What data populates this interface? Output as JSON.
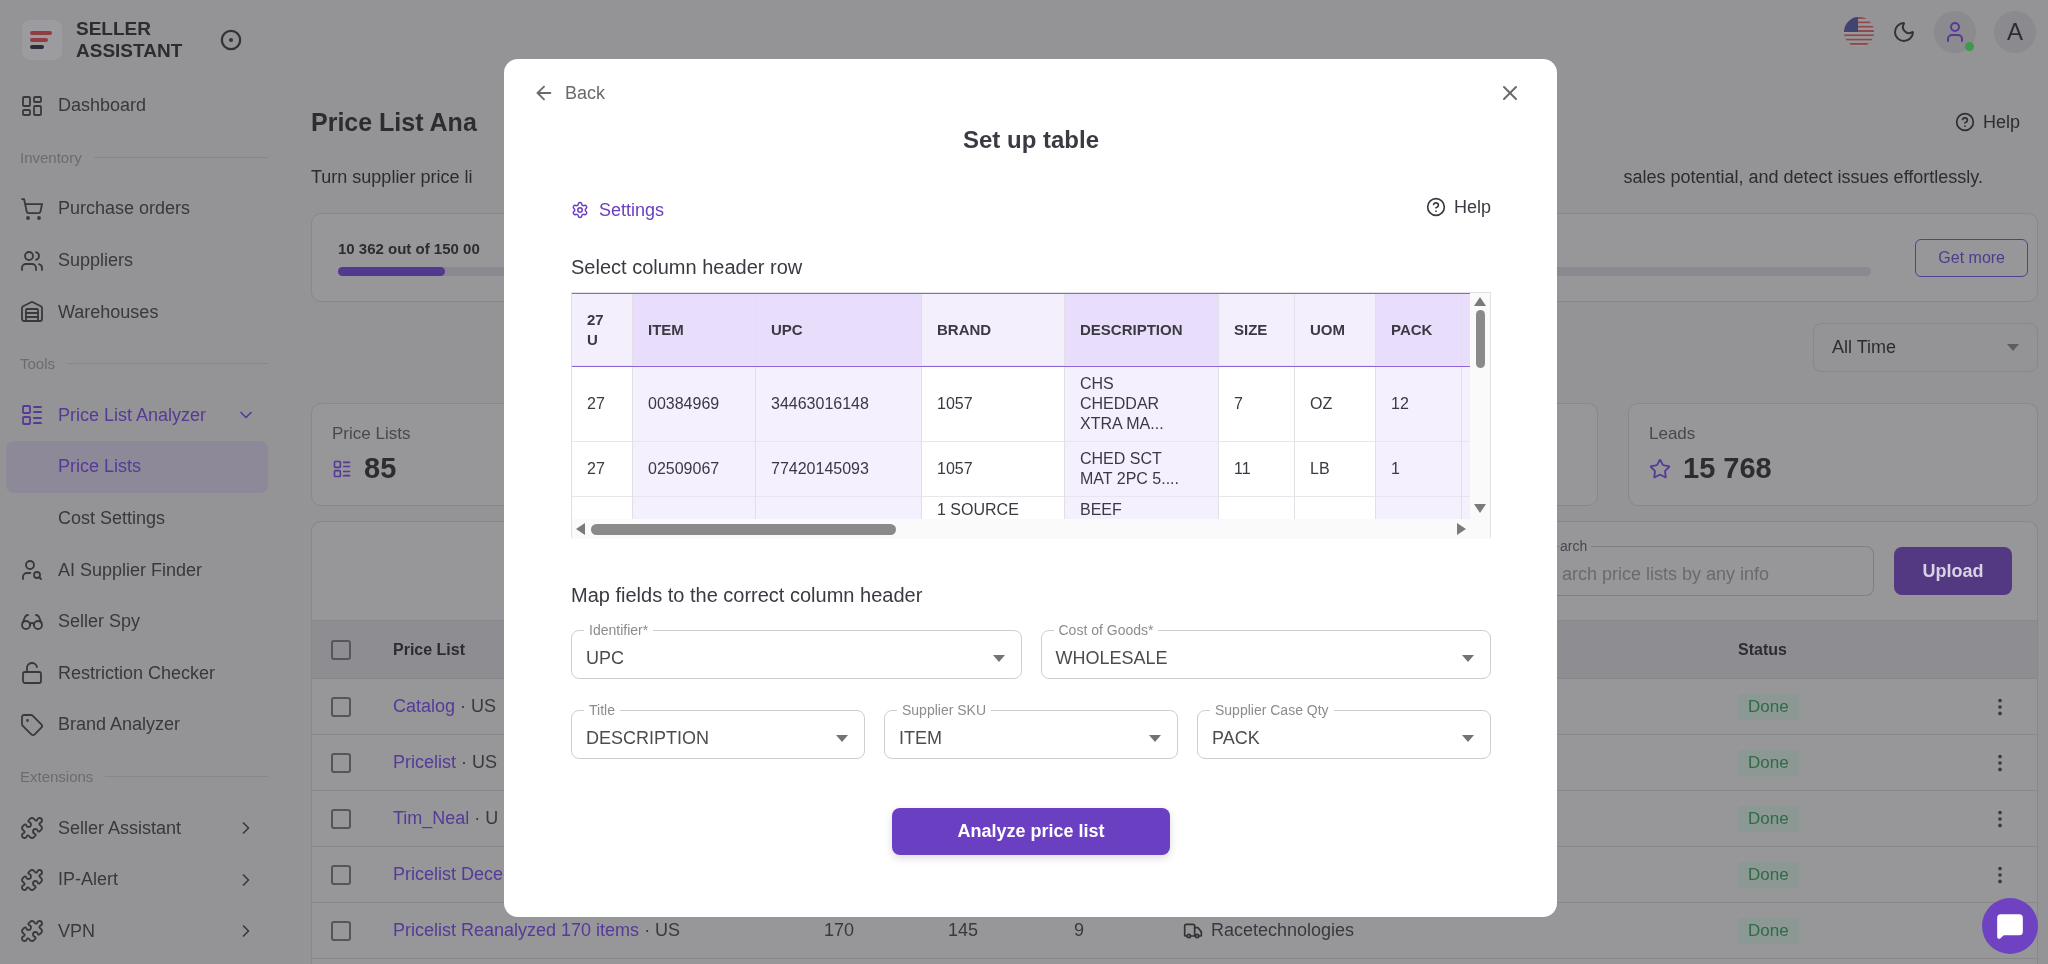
{
  "sidebar": {
    "brand": "SELLER ASSISTANT",
    "items": [
      {
        "kind": "item",
        "label": "Dashboard",
        "selected": false
      },
      {
        "kind": "section",
        "label": "Inventory"
      },
      {
        "kind": "item",
        "label": "Purchase orders",
        "selected": false
      },
      {
        "kind": "item",
        "label": "Suppliers",
        "selected": false
      },
      {
        "kind": "item",
        "label": "Warehouses",
        "selected": false
      },
      {
        "kind": "section",
        "label": "Tools"
      },
      {
        "kind": "item",
        "label": "Price List Analyzer",
        "selected": true,
        "expanded": true
      },
      {
        "kind": "subitem",
        "label": "Price Lists",
        "selected": true
      },
      {
        "kind": "subitem",
        "label": "Cost Settings",
        "selected": false
      },
      {
        "kind": "item",
        "label": "AI Supplier Finder",
        "selected": false
      },
      {
        "kind": "item",
        "label": "Seller Spy",
        "selected": false
      },
      {
        "kind": "item",
        "label": "Restriction Checker",
        "selected": false
      },
      {
        "kind": "item",
        "label": "Brand Analyzer",
        "selected": false
      },
      {
        "kind": "section",
        "label": "Extensions"
      },
      {
        "kind": "item",
        "label": "Seller Assistant",
        "selected": false,
        "expanded": false
      },
      {
        "kind": "item",
        "label": "IP-Alert",
        "selected": false,
        "expanded": false
      },
      {
        "kind": "item",
        "label": "VPN",
        "selected": false,
        "expanded": false
      }
    ]
  },
  "top_bar": {
    "avatar": "A"
  },
  "page": {
    "title": "Price List Ana",
    "help": "Help",
    "subtitle_left": "Turn supplier price li",
    "subtitle_right": "sales potential, and detect issues effortlessly."
  },
  "usage": {
    "text": "10 362 out of 150 00",
    "level": 0.07,
    "button": "Get more"
  },
  "period": {
    "value": "All Time"
  },
  "stats": [
    {
      "label": "Price Lists",
      "value": "85"
    },
    {
      "label": "Leads",
      "value": "15 768"
    }
  ],
  "table": {
    "search": {
      "label": "arch",
      "placeholder": "arch price lists by any info"
    },
    "upload": "Upload",
    "header": {
      "checked": false,
      "name": "Price List",
      "status": "Status"
    },
    "rows": [
      {
        "checked": false,
        "name": "Catalog",
        "suffix": " · US",
        "status": "Done"
      },
      {
        "checked": false,
        "name": "Pricelist",
        "suffix": " · US",
        "status": "Done"
      },
      {
        "checked": false,
        "name": "Tim_Neal",
        "suffix": " · U",
        "status": "Done"
      },
      {
        "checked": false,
        "name": "Pricelist Dece",
        "status": "Done"
      },
      {
        "checked": false,
        "name": "Pricelist Reanalyzed 170 items",
        "suffix": " · US",
        "column_2": "170",
        "column_3": "145",
        "column_4": "9",
        "column_5": "Racetechnologies",
        "status": "Done"
      }
    ]
  },
  "dialog": {
    "back": "Back",
    "title": "Set up table",
    "settings": "Settings",
    "help": "Help",
    "preview_label": "Select column header row",
    "columns": [
      {
        "mapped": false
      },
      {
        "mapped": true
      },
      {
        "mapped": true
      },
      {
        "mapped": false
      },
      {
        "mapped": true
      },
      {
        "mapped": false
      },
      {
        "mapped": false
      },
      {
        "mapped": true
      }
    ],
    "rows": [
      {
        "selected": true,
        "cells": [
          "27 U",
          "ITEM",
          "UPC",
          "BRAND",
          "DESCRIPTION",
          "SIZE",
          "UOM",
          "PACK"
        ]
      },
      {
        "selected": false,
        "cells": [
          "27",
          "00384969",
          "34463016148",
          "1057",
          "CHS CHEDDAR XTRA MA...",
          "7",
          "OZ",
          "12"
        ]
      },
      {
        "selected": false,
        "cells": [
          "27",
          "02509067",
          "77420145093",
          "1057",
          "CHED SCT MAT 2PC 5....",
          "11",
          "LB",
          "1"
        ]
      },
      {
        "selected": false,
        "cells": [
          null,
          null,
          null,
          "1 SOURCE",
          "BEEF",
          null,
          null,
          null
        ]
      }
    ],
    "mapping_label": "Map fields to the correct column header",
    "fields": [
      {
        "label": "Identifier*",
        "value": "UPC"
      },
      {
        "label": "Cost of Goods*",
        "value": "WHOLESALE"
      },
      {
        "label": "Title",
        "value": "DESCRIPTION"
      },
      {
        "label": "Supplier SKU",
        "value": "ITEM"
      },
      {
        "label": "Supplier Case Qty",
        "value": "PACK"
      }
    ],
    "submit": "Analyze price list"
  }
}
